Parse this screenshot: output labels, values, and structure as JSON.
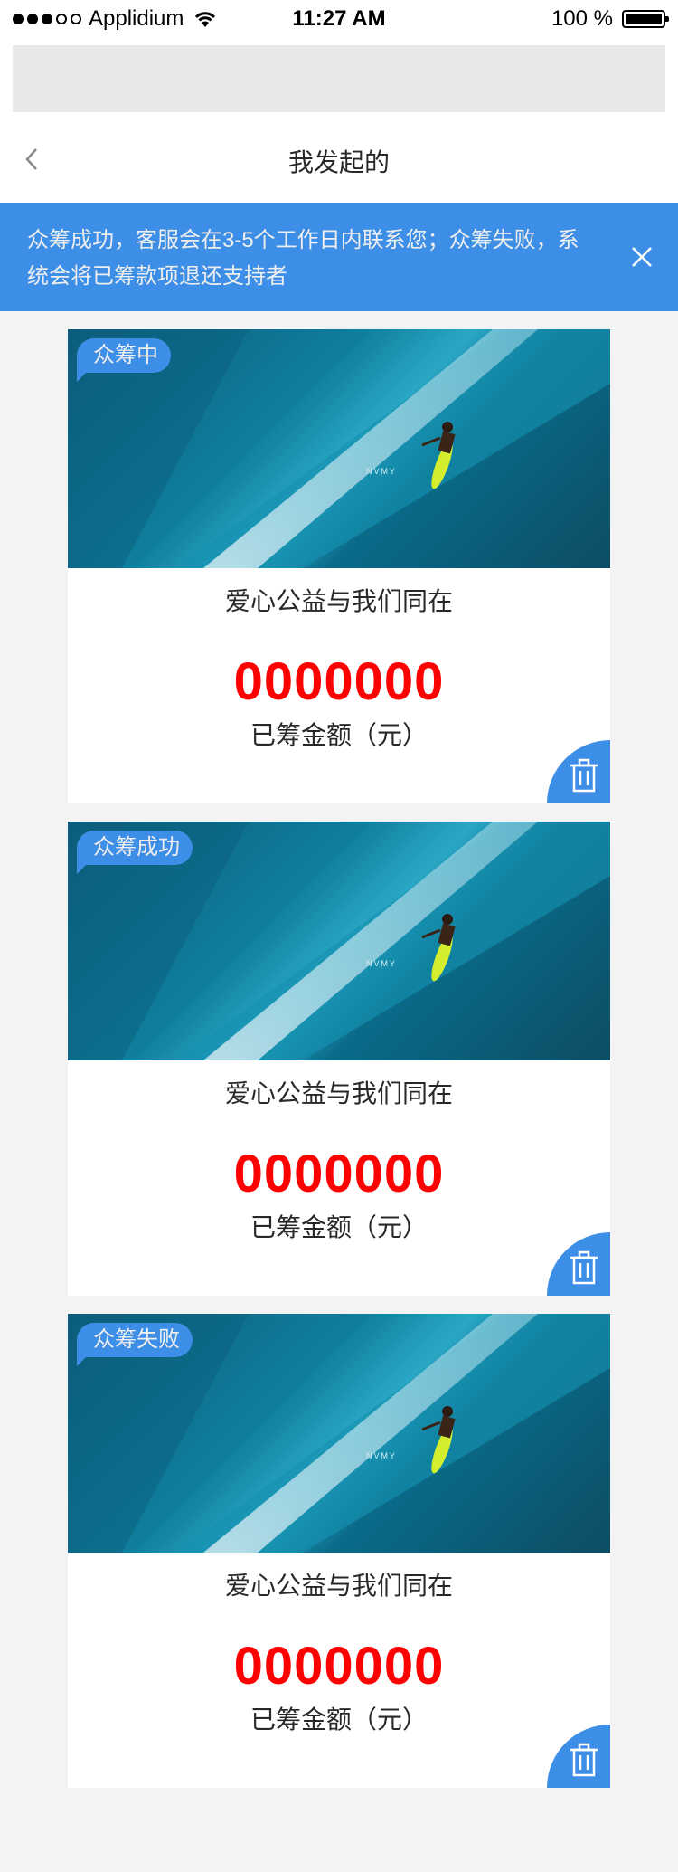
{
  "status_bar": {
    "carrier": "Applidium",
    "time": "11:27 AM",
    "battery": "100 %"
  },
  "nav": {
    "title": "我发起的",
    "back_icon": "chevron-left-icon"
  },
  "notice": {
    "text": "众筹成功，客服会在3-5个工作日内联系您；众筹失败，系统会将已筹款项退还支持者",
    "close_icon": "close-icon",
    "background": "#3d8ee6",
    "text_color": "#eeeeee"
  },
  "cards": [
    {
      "tag": "众筹中",
      "title": "爱心公益与我们同在",
      "amount": "0000000",
      "amount_label": "已筹金额（元）"
    },
    {
      "tag": "众筹成功",
      "title": "爱心公益与我们同在",
      "amount": "0000000",
      "amount_label": "已筹金额（元）"
    },
    {
      "tag": "众筹失败",
      "title": "爱心公益与我们同在",
      "amount": "0000000",
      "amount_label": "已筹金额（元）"
    }
  ],
  "colors": {
    "accent": "#3d8ee6",
    "amount": "#ff0000",
    "text": "#282828",
    "page_bg": "#f3f3f3"
  }
}
